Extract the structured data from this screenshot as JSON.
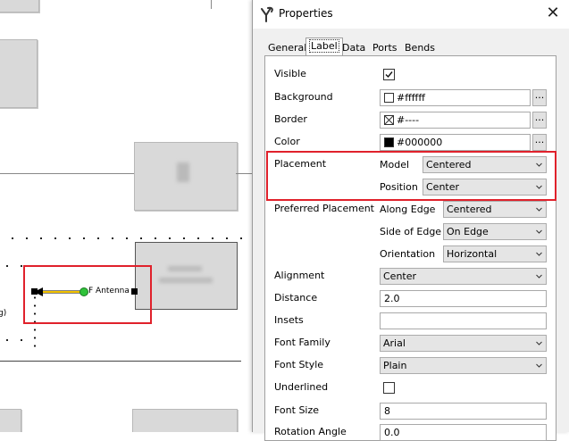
{
  "dialog": {
    "title": "Properties",
    "close_glyph": "✕",
    "tabs": [
      {
        "label": "General"
      },
      {
        "label": "Label",
        "active": true
      },
      {
        "label": "Data"
      },
      {
        "label": "Ports"
      },
      {
        "label": "Bends"
      }
    ],
    "props": {
      "visible": {
        "label": "Visible",
        "checked": true
      },
      "background": {
        "label": "Background",
        "value": "#ffffff",
        "swatch": "#ffffff"
      },
      "border": {
        "label": "Border",
        "value": "#----"
      },
      "color": {
        "label": "Color",
        "value": "#000000",
        "swatch": "#000000"
      },
      "placement": {
        "label": "Placement",
        "model_label": "Model",
        "model_value": "Centered",
        "position_label": "Position",
        "position_value": "Center"
      },
      "preferred_placement": {
        "label": "Preferred Placement",
        "along_edge_label": "Along Edge",
        "along_edge_value": "Centered",
        "side_of_edge_label": "Side of Edge",
        "side_of_edge_value": "On Edge",
        "orientation_label": "Orientation",
        "orientation_value": "Horizontal"
      },
      "alignment": {
        "label": "Alignment",
        "value": "Center"
      },
      "distance": {
        "label": "Distance",
        "value": "2.0"
      },
      "insets": {
        "label": "Insets",
        "value": ""
      },
      "font_family": {
        "label": "Font Family",
        "value": "Arial"
      },
      "font_style": {
        "label": "Font Style",
        "value": "Plain"
      },
      "underlined": {
        "label": "Underlined",
        "checked": false
      },
      "font_size": {
        "label": "Font Size",
        "value": "8"
      },
      "rotation_angle": {
        "label": "Rotation Angle",
        "value": "0.0"
      }
    },
    "ellipsis": "..."
  },
  "diagram": {
    "edge_label": "Antenna",
    "partial_label": "g)"
  },
  "colors": {
    "highlight": "#e0212b",
    "edge": "#f2c200",
    "port_green": "#2fc23a"
  }
}
